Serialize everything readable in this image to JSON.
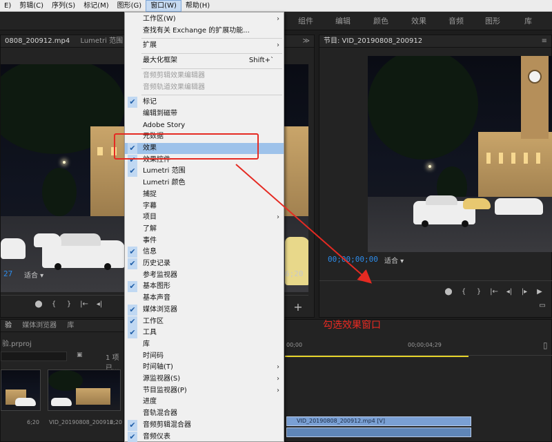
{
  "menubar": {
    "items": [
      "E)",
      "剪辑(C)",
      "序列(S)",
      "标记(M)",
      "图形(G)",
      "窗口(W)",
      "帮助(H)"
    ],
    "active_index": 5
  },
  "workspace_tabs": [
    "组件",
    "编辑",
    "颜色",
    "效果",
    "音频",
    "图形",
    "库"
  ],
  "source_panel": {
    "tabs": [
      "0808_200912.mp4",
      "Lumetri 范围"
    ],
    "timecode_left": "27",
    "fit_label": "适合",
    "timecode_right": "6;20"
  },
  "program_panel": {
    "title": "节目: VID_20190808_200912",
    "timecode": "00;00;00;00",
    "fit_label": "适合"
  },
  "project_panel": {
    "tabs": [
      "验",
      "媒体浏览器",
      "库"
    ],
    "project_name": "验.prproj",
    "item_count": "1 项已...",
    "thumbs": [
      {
        "label": "",
        "duration": "6;20"
      },
      {
        "label": "VID_20190808_200912...",
        "duration": "6;20"
      }
    ]
  },
  "timeline": {
    "time_labels": [
      "00;00",
      "00;00;04;29"
    ],
    "clip_label": "VID_20190808_200912.mp4 [V]"
  },
  "window_menu": {
    "items": [
      {
        "label": "工作区(W)",
        "submenu": true
      },
      {
        "label": "查找有关 Exchange 的扩展功能..."
      },
      {
        "separator": true
      },
      {
        "label": "扩展",
        "submenu": true
      },
      {
        "separator": true
      },
      {
        "label": "最大化框架",
        "shortcut": "Shift+`"
      },
      {
        "separator": true
      },
      {
        "label": "音频剪辑效果编辑器",
        "disabled": true
      },
      {
        "label": "音频轨道效果编辑器",
        "disabled": true
      },
      {
        "separator": true
      },
      {
        "label": "标记",
        "checked": true
      },
      {
        "label": "编辑到磁带"
      },
      {
        "label": "Adobe Story"
      },
      {
        "label": "元数据"
      },
      {
        "label": "效果",
        "checked": true,
        "highlight": true
      },
      {
        "label": "效果控件",
        "checked": true
      },
      {
        "label": "Lumetri 范围",
        "checked": true
      },
      {
        "label": "Lumetri 颜色"
      },
      {
        "label": "捕捉"
      },
      {
        "label": "字幕"
      },
      {
        "label": "项目",
        "submenu": true
      },
      {
        "label": "了解"
      },
      {
        "label": "事件"
      },
      {
        "label": "信息",
        "checked": true
      },
      {
        "label": "历史记录",
        "checked": true
      },
      {
        "label": "参考监视器"
      },
      {
        "label": "基本图形",
        "checked": true
      },
      {
        "label": "基本声音"
      },
      {
        "label": "媒体浏览器",
        "checked": true
      },
      {
        "label": "工作区",
        "checked": true
      },
      {
        "label": "工具",
        "checked": true
      },
      {
        "label": "库"
      },
      {
        "label": "时间码"
      },
      {
        "label": "时间轴(T)",
        "submenu": true
      },
      {
        "label": "源监视器(S)",
        "submenu": true
      },
      {
        "label": "节目监视器(P)",
        "submenu": true
      },
      {
        "label": "进度"
      },
      {
        "label": "音轨混合器"
      },
      {
        "label": "音频剪辑混合器",
        "checked": true
      },
      {
        "label": "音频仪表",
        "checked": true
      }
    ]
  },
  "annotation": {
    "text": "勾选效果窗口",
    "color": "#ea2a22"
  },
  "icons": {
    "check": "✔",
    "submenu_arrow": "›",
    "add": "+"
  }
}
